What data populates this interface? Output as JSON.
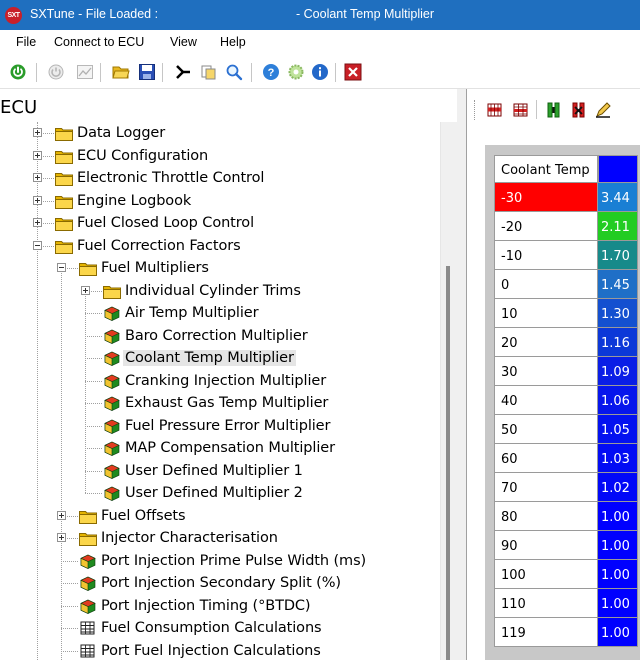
{
  "window": {
    "title_left": "SXTune - File Loaded :",
    "title_right": "- Coolant Temp Multiplier",
    "app_icon_text": "SXT"
  },
  "menu": [
    "File",
    "Connect to ECU",
    "View",
    "Help"
  ],
  "toolbar_icons": [
    "power-icon",
    "disconnect-icon",
    "chart-icon",
    "open-folder-icon",
    "save-icon",
    "send-icon",
    "copy-icon",
    "search-icon",
    "help-icon",
    "settings-icon",
    "info-icon",
    "close-icon"
  ],
  "ecu_pane": {
    "title": "ECU",
    "tree": [
      {
        "label": "Data Logger",
        "type": "folder",
        "level": 0,
        "expander": "plus"
      },
      {
        "label": "ECU Configuration",
        "type": "folder",
        "level": 0,
        "expander": "plus"
      },
      {
        "label": "Electronic Throttle Control",
        "type": "folder",
        "level": 0,
        "expander": "plus"
      },
      {
        "label": "Engine Logbook",
        "type": "folder",
        "level": 0,
        "expander": "plus"
      },
      {
        "label": "Fuel Closed Loop Control",
        "type": "folder",
        "level": 0,
        "expander": "plus"
      },
      {
        "label": "Fuel Correction Factors",
        "type": "folder",
        "level": 0,
        "expander": "minus"
      },
      {
        "label": "Fuel Multipliers",
        "type": "folder",
        "level": 1,
        "expander": "minus"
      },
      {
        "label": "Individual Cylinder Trims",
        "type": "folder",
        "level": 2,
        "expander": "plus"
      },
      {
        "label": "Air Temp Multiplier",
        "type": "cube",
        "level": 2
      },
      {
        "label": "Baro Correction Multiplier",
        "type": "cube",
        "level": 2
      },
      {
        "label": "Coolant Temp Multiplier",
        "type": "cube",
        "level": 2,
        "selected": true
      },
      {
        "label": "Cranking Injection Multiplier",
        "type": "cube",
        "level": 2
      },
      {
        "label": "Exhaust Gas Temp Multiplier",
        "type": "cube",
        "level": 2
      },
      {
        "label": "Fuel Pressure Error Multiplier",
        "type": "cube",
        "level": 2
      },
      {
        "label": "MAP Compensation Multiplier",
        "type": "cube",
        "level": 2
      },
      {
        "label": "User Defined Multiplier 1",
        "type": "cube",
        "level": 2
      },
      {
        "label": "User Defined Multiplier 2",
        "type": "cube",
        "level": 2
      },
      {
        "label": "Fuel Offsets",
        "type": "folder",
        "level": 1,
        "expander": "plus"
      },
      {
        "label": "Injector Characterisation",
        "type": "folder",
        "level": 1,
        "expander": "plus"
      },
      {
        "label": "Port Injection Prime Pulse Width (ms)",
        "type": "cube",
        "level": 1
      },
      {
        "label": "Port Injection Secondary Split (%)",
        "type": "cube",
        "level": 1
      },
      {
        "label": "Port Injection Timing (°BTDC)",
        "type": "cube",
        "level": 1
      },
      {
        "label": "Fuel Consumption Calculations",
        "type": "table",
        "level": 1
      },
      {
        "label": "Port Fuel Injection Calculations",
        "type": "table",
        "level": 1
      }
    ]
  },
  "right_toolbar_icons": [
    "insert-row-icon",
    "insert-table-icon",
    "split-column-icon",
    "delete-column-icon",
    "edit-icon"
  ],
  "table": {
    "header": "Coolant Temp",
    "header_color": "#0000ff",
    "rows": [
      {
        "temp": "-30",
        "value": "3.44",
        "color": "#1a7fd4",
        "temp_bg": "#ff0000"
      },
      {
        "temp": "-20",
        "value": "2.11",
        "color": "#22cc22"
      },
      {
        "temp": "-10",
        "value": "1.70",
        "color": "#178a8a"
      },
      {
        "temp": "0",
        "value": "1.45",
        "color": "#1f6fc7"
      },
      {
        "temp": "10",
        "value": "1.30",
        "color": "#1450d0"
      },
      {
        "temp": "20",
        "value": "1.16",
        "color": "#0c38d8"
      },
      {
        "temp": "30",
        "value": "1.09",
        "color": "#0a1ee6"
      },
      {
        "temp": "40",
        "value": "1.06",
        "color": "#0716ec"
      },
      {
        "temp": "50",
        "value": "1.05",
        "color": "#0412f0"
      },
      {
        "temp": "60",
        "value": "1.03",
        "color": "#020cf4"
      },
      {
        "temp": "70",
        "value": "1.02",
        "color": "#0108f8"
      },
      {
        "temp": "80",
        "value": "1.00",
        "color": "#0000ff"
      },
      {
        "temp": "90",
        "value": "1.00",
        "color": "#0000ff"
      },
      {
        "temp": "100",
        "value": "1.00",
        "color": "#0000ff"
      },
      {
        "temp": "110",
        "value": "1.00",
        "color": "#0000ff"
      },
      {
        "temp": "119",
        "value": "1.00",
        "color": "#0000ff"
      }
    ]
  }
}
